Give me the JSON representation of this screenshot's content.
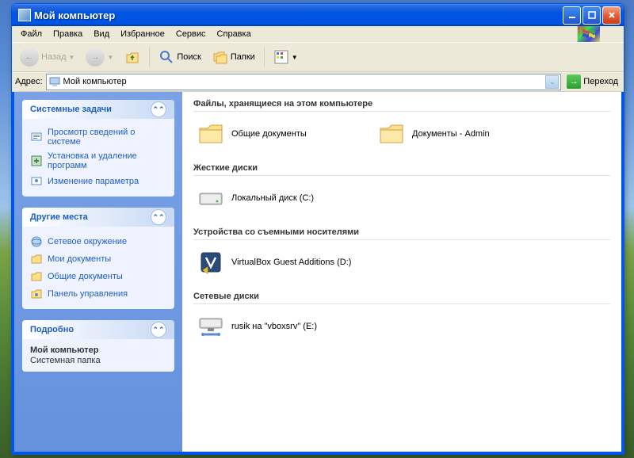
{
  "window": {
    "title": "Мой компьютер"
  },
  "menu": {
    "file": "Файл",
    "edit": "Правка",
    "view": "Вид",
    "favorites": "Избранное",
    "tools": "Сервис",
    "help": "Справка"
  },
  "toolbar": {
    "back": "Назад",
    "search": "Поиск",
    "folders": "Папки"
  },
  "address": {
    "label": "Адрес:",
    "value": "Мой компьютер",
    "go": "Переход"
  },
  "sidebar": {
    "system": {
      "title": "Системные задачи",
      "items": [
        {
          "label": "Просмотр сведений о системе"
        },
        {
          "label": "Установка и удаление программ"
        },
        {
          "label": "Изменение параметра"
        }
      ]
    },
    "places": {
      "title": "Другие места",
      "items": [
        {
          "label": "Сетевое окружение"
        },
        {
          "label": "Мои документы"
        },
        {
          "label": "Общие документы"
        },
        {
          "label": "Панель управления"
        }
      ]
    },
    "details": {
      "title": "Подробно",
      "name": "Мой компьютер",
      "type": "Системная папка"
    }
  },
  "groups": [
    {
      "title": "Файлы, хранящиеся на этом компьютере",
      "items": [
        {
          "name": "Общие документы",
          "icon": "folder"
        },
        {
          "name": "Документы - Admin",
          "icon": "folder"
        }
      ]
    },
    {
      "title": "Жесткие диски",
      "items": [
        {
          "name": "Локальный диск (C:)",
          "icon": "hdd"
        }
      ]
    },
    {
      "title": "Устройства со съемными носителями",
      "items": [
        {
          "name": "VirtualBox Guest Additions (D:)",
          "icon": "vbox"
        }
      ]
    },
    {
      "title": "Сетевые диски",
      "items": [
        {
          "name": "rusik на \"vboxsrv\" (E:)",
          "icon": "netdrive"
        }
      ]
    }
  ]
}
